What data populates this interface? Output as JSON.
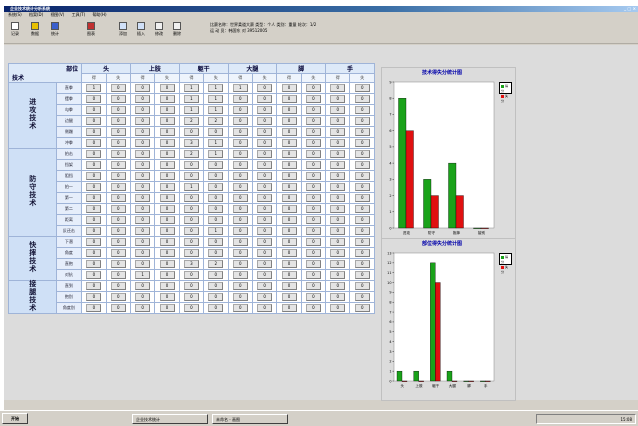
{
  "window": {
    "title": "企业技术统计分析系统",
    "controls": "_ □ ×"
  },
  "menu": [
    "系统(S)",
    "档案(D)",
    "视图(V)",
    "工具(T)",
    "帮助(H)"
  ],
  "toolbar": {
    "buttons": [
      {
        "label": "记录",
        "icon": "record-icon"
      },
      {
        "label": "数据",
        "icon": "data-icon"
      },
      {
        "label": "统计",
        "icon": "stats-icon"
      },
      {
        "label": "图表",
        "icon": "chart-icon"
      },
      {
        "label": "添加",
        "icon": "add-icon"
      },
      {
        "label": "插入",
        "icon": "insert-icon"
      },
      {
        "label": "修改",
        "icon": "edit-icon"
      },
      {
        "label": "删除",
        "icon": "delete-icon"
      }
    ],
    "info_line1": "比赛名称：世界柔道大赛  类型：个人  类别：重量  轮次：1/2",
    "info_line2": "运 动 员：韩国东  对  39512005"
  },
  "table": {
    "corner_top": "部位",
    "corner_bottom": "技术",
    "parts": [
      "头",
      "上肢",
      "躯干",
      "大腿",
      "脚",
      "手"
    ],
    "subcols": [
      "得",
      "失"
    ],
    "groups": [
      {
        "name": "进攻技术",
        "rows": [
          {
            "tech": "直拳",
            "vals": [
              1,
              0,
              0,
              0,
              1,
              1,
              1,
              0,
              0,
              0,
              0,
              0
            ]
          },
          {
            "tech": "摆拳",
            "vals": [
              0,
              0,
              0,
              0,
              1,
              1,
              0,
              0,
              0,
              0,
              0,
              0
            ]
          },
          {
            "tech": "勾拳",
            "vals": [
              0,
              0,
              0,
              0,
              1,
              1,
              0,
              0,
              0,
              0,
              0,
              0
            ]
          },
          {
            "tech": "边腿",
            "vals": [
              0,
              0,
              0,
              0,
              2,
              2,
              0,
              0,
              0,
              0,
              0,
              0
            ]
          },
          {
            "tech": "侧踹",
            "vals": [
              0,
              0,
              0,
              0,
              0,
              0,
              0,
              0,
              0,
              0,
              0,
              0
            ]
          },
          {
            "tech": "冲拳",
            "vals": [
              0,
              0,
              0,
              0,
              3,
              1,
              0,
              0,
              0,
              0,
              0,
              0
            ]
          }
        ]
      },
      {
        "name": "防守技术",
        "rows": [
          {
            "tech": "拍击",
            "vals": [
              0,
              0,
              0,
              0,
              2,
              1,
              0,
              0,
              0,
              0,
              0,
              0
            ]
          },
          {
            "tech": "挡架",
            "vals": [
              0,
              0,
              0,
              0,
              0,
              0,
              0,
              0,
              0,
              0,
              0,
              0
            ]
          },
          {
            "tech": "阻挡",
            "vals": [
              0,
              0,
              0,
              0,
              0,
              0,
              0,
              0,
              0,
              0,
              0,
              0
            ]
          },
          {
            "tech": "拍一",
            "vals": [
              0,
              0,
              0,
              0,
              1,
              0,
              0,
              0,
              0,
              0,
              0,
              0
            ]
          },
          {
            "tech": "第一",
            "vals": [
              0,
              0,
              0,
              0,
              0,
              0,
              0,
              0,
              0,
              0,
              0,
              0
            ]
          },
          {
            "tech": "第二",
            "vals": [
              0,
              0,
              0,
              0,
              0,
              0,
              0,
              0,
              0,
              0,
              0,
              0
            ]
          },
          {
            "tech": "距离",
            "vals": [
              0,
              0,
              0,
              0,
              0,
              0,
              0,
              0,
              0,
              0,
              0,
              0
            ]
          },
          {
            "tech": "反还击",
            "vals": [
              0,
              0,
              0,
              0,
              0,
              1,
              0,
              0,
              0,
              0,
              0,
              0
            ]
          }
        ]
      },
      {
        "name": "快摔技术",
        "rows": [
          {
            "tech": "下潜",
            "vals": [
              0,
              0,
              0,
              0,
              0,
              0,
              0,
              0,
              0,
              0,
              0,
              0
            ]
          },
          {
            "tech": "角度",
            "vals": [
              0,
              0,
              0,
              0,
              0,
              0,
              0,
              0,
              0,
              0,
              0,
              0
            ]
          },
          {
            "tech": "直抱",
            "vals": [
              0,
              0,
              0,
              0,
              3,
              2,
              0,
              0,
              0,
              0,
              0,
              0
            ]
          },
          {
            "tech": "对抗",
            "vals": [
              0,
              0,
              1,
              0,
              0,
              0,
              0,
              0,
              0,
              0,
              0,
              0
            ]
          }
        ]
      },
      {
        "name": "接腿技术",
        "rows": [
          {
            "tech": "直到",
            "vals": [
              0,
              0,
              0,
              0,
              0,
              0,
              0,
              0,
              0,
              0,
              0,
              0
            ]
          },
          {
            "tech": "抱别",
            "vals": [
              0,
              0,
              0,
              0,
              0,
              0,
              0,
              0,
              0,
              0,
              0,
              0
            ]
          },
          {
            "tech": "角度别",
            "vals": [
              0,
              0,
              0,
              0,
              0,
              0,
              0,
              0,
              0,
              0,
              0,
              0
            ]
          }
        ]
      }
    ]
  },
  "legend": {
    "gain": "得分",
    "loss": "失分",
    "gain_color": "#1aa21a",
    "loss_color": "#e01010"
  },
  "chart_data": [
    {
      "type": "bar",
      "title": "技术得失分统计图",
      "categories": [
        "进攻",
        "防守",
        "抱摔",
        "接别"
      ],
      "series": [
        {
          "name": "得分",
          "values": [
            8,
            3,
            4,
            0
          ]
        },
        {
          "name": "失分",
          "values": [
            6,
            2,
            2,
            0
          ]
        }
      ],
      "ylim": [
        0,
        9
      ],
      "yticks": [
        0,
        1,
        2,
        3,
        4,
        5,
        6,
        7,
        8,
        9
      ]
    },
    {
      "type": "bar",
      "title": "部位得失分统计图",
      "categories": [
        "头",
        "上肢",
        "躯干",
        "大腿",
        "脚",
        "手"
      ],
      "series": [
        {
          "name": "得分",
          "values": [
            1,
            1,
            12,
            1,
            0,
            0
          ]
        },
        {
          "name": "失分",
          "values": [
            0,
            0,
            10,
            0,
            0,
            0
          ]
        }
      ],
      "ylim": [
        0,
        13
      ],
      "yticks": [
        0,
        1,
        2,
        3,
        4,
        5,
        6,
        7,
        8,
        9,
        10,
        11,
        12,
        13
      ]
    }
  ],
  "taskbar": {
    "start": "开始",
    "tasks": [
      "企业技术统计",
      "未命名 - 画图"
    ],
    "tray": "15:08"
  }
}
